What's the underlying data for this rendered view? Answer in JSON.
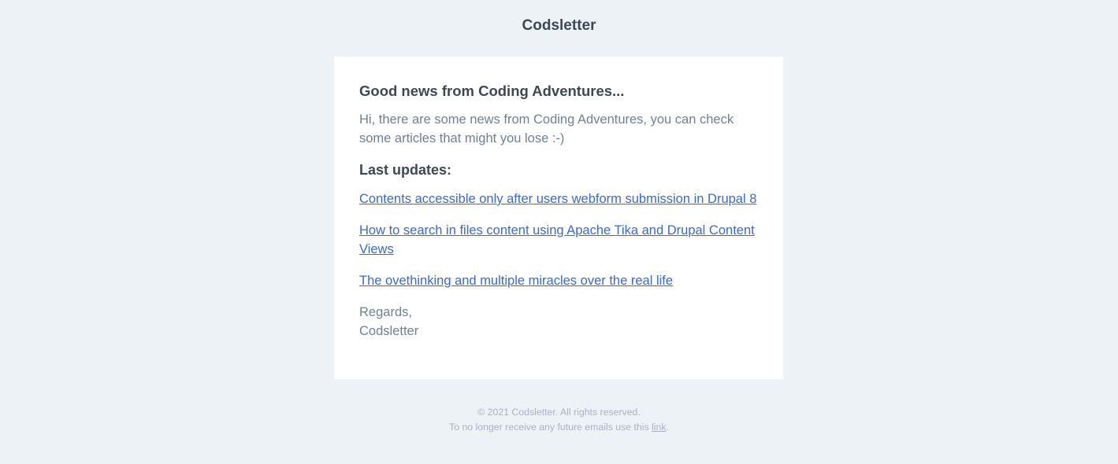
{
  "header": {
    "brand": "Codsletter"
  },
  "email": {
    "heading": "Good news from Coding Adventures...",
    "intro": "Hi, there are some news from Coding Adventures, you can check some articles that might you lose :-)",
    "updates_title": "Last updates:",
    "articles": [
      {
        "title": "Contents accessible only after users webform submission in Drupal 8"
      },
      {
        "title": "How to search in files content using Apache Tika and Drupal Content Views"
      },
      {
        "title": "The ovethinking and multiple miracles over the real life"
      }
    ],
    "regards": "Regards,",
    "signature": "Codsletter"
  },
  "footer": {
    "copyright": "© 2021 Codsletter. All rights reserved.",
    "unsubscribe_text": "To no longer receive any future emails use this ",
    "unsubscribe_link": "link",
    "unsubscribe_suffix": "."
  },
  "colors": {
    "background": "#edf2f7",
    "card": "#ffffff",
    "heading_text": "#3d4852",
    "body_text": "#718096",
    "link": "#3869d4",
    "footer_text": "#b0adc5"
  }
}
